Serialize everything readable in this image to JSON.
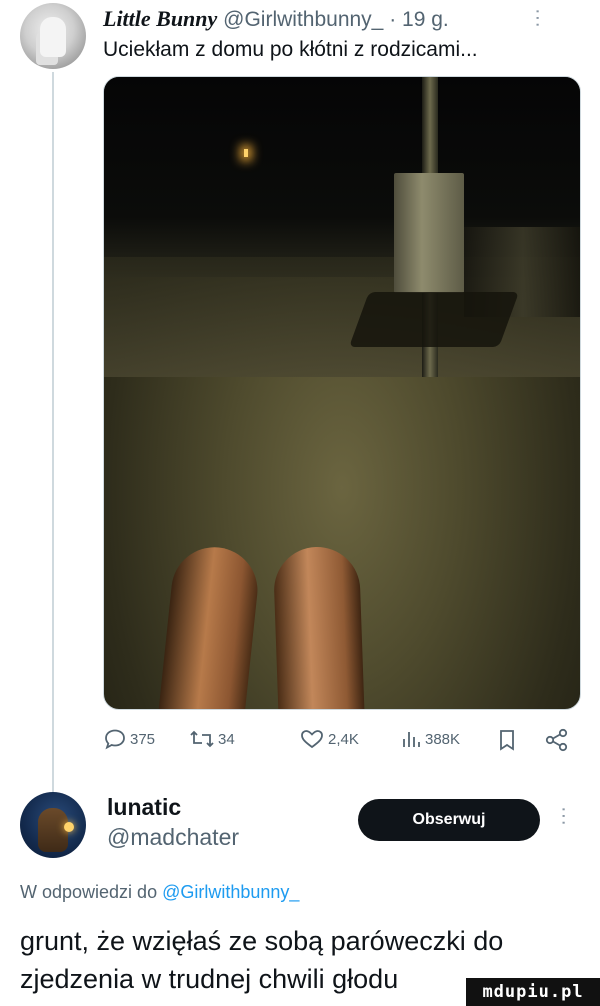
{
  "tweet1": {
    "display_name": "Little Bunny",
    "handle": "@Girlwithbunny_",
    "time": "· 19 g.",
    "text": "Uciekłam z domu po kłótni z rodzicami...",
    "stats": {
      "replies": "375",
      "retweets": "34",
      "likes": "2,4K",
      "views": "388K"
    },
    "icons": [
      "reply-icon",
      "retweet-icon",
      "like-icon",
      "views-icon",
      "bookmark-icon",
      "share-icon",
      "more-icon"
    ]
  },
  "tweet2": {
    "display_name": "lunatic",
    "handle": "@madchater",
    "follow_label": "Obserwuj",
    "reply_prefix": "W odpowiedzi do ",
    "reply_mention": "@Girlwithbunny_",
    "text": "grunt, że wzięłaś ze sobą paróweczki do zjedzenia w trudnej chwili głodu"
  },
  "watermark": "mdupiu.pl"
}
